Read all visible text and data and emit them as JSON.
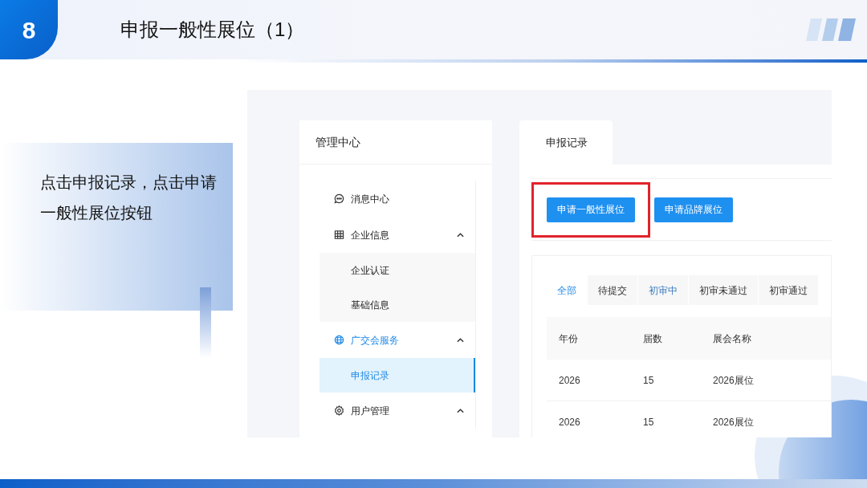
{
  "slide": {
    "number": "8",
    "title": "申报一般性展位（1）",
    "instruction": "点击申报记录，点击申请一般性展位按钮"
  },
  "screenshot": {
    "sidebar": {
      "title": "管理中心",
      "items": [
        {
          "label": "消息中心",
          "active": false,
          "expanded": false
        },
        {
          "label": "企业信息",
          "active": false,
          "expanded": true,
          "children": [
            {
              "label": "企业认证",
              "selected": false
            },
            {
              "label": "基础信息",
              "selected": false
            }
          ]
        },
        {
          "label": "广交会服务",
          "active": true,
          "expanded": true,
          "children": [
            {
              "label": "申报记录",
              "selected": true
            }
          ]
        },
        {
          "label": "用户管理",
          "active": false,
          "expanded": true
        }
      ]
    },
    "page_tabs": [
      {
        "label": "申报记录",
        "selected": true
      }
    ],
    "buttons": [
      {
        "label": "申请一般性展位",
        "highlighted": true
      },
      {
        "label": "申请品牌展位"
      }
    ],
    "status_tabs": [
      {
        "label": "全部",
        "selected": true,
        "hovered": false
      },
      {
        "label": "待提交",
        "selected": false,
        "hovered": false
      },
      {
        "label": "初审中",
        "selected": false,
        "hovered": true
      },
      {
        "label": "初审未通过",
        "selected": false,
        "hovered": false
      },
      {
        "label": "初审通过",
        "selected": false,
        "hovered": false
      }
    ],
    "table": {
      "columns": [
        "年份",
        "届数",
        "展会名称"
      ],
      "rows": [
        [
          "2026",
          "15",
          "2026展位"
        ],
        [
          "2026",
          "15",
          "2026展位"
        ]
      ]
    }
  }
}
